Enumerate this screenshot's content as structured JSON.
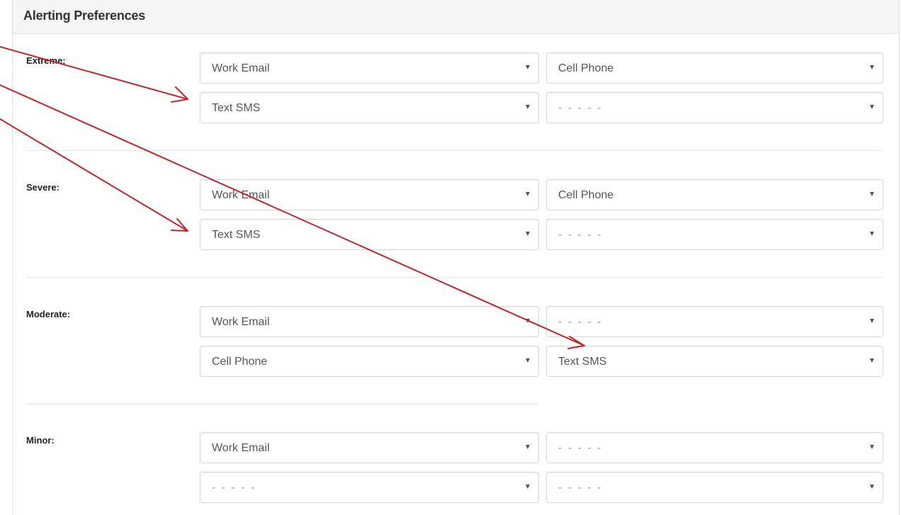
{
  "panel": {
    "title": "Alerting Preferences"
  },
  "levels": [
    {
      "label": "Extreme:",
      "selects": [
        "Work Email",
        "Cell Phone",
        "Text SMS",
        "- - - - -"
      ]
    },
    {
      "label": "Severe:",
      "selects": [
        "Work Email",
        "Cell Phone",
        "Text SMS",
        "- - - - -"
      ]
    },
    {
      "label": "Moderate:",
      "selects": [
        "Work Email",
        "- - - - -",
        "Cell Phone",
        "Text SMS"
      ]
    },
    {
      "label": "Minor:",
      "selects": [
        "Work Email",
        "- - - - -",
        "- - - - -",
        "- - - - -"
      ]
    }
  ],
  "annotation": {
    "arrow_color": "#c0272d"
  }
}
